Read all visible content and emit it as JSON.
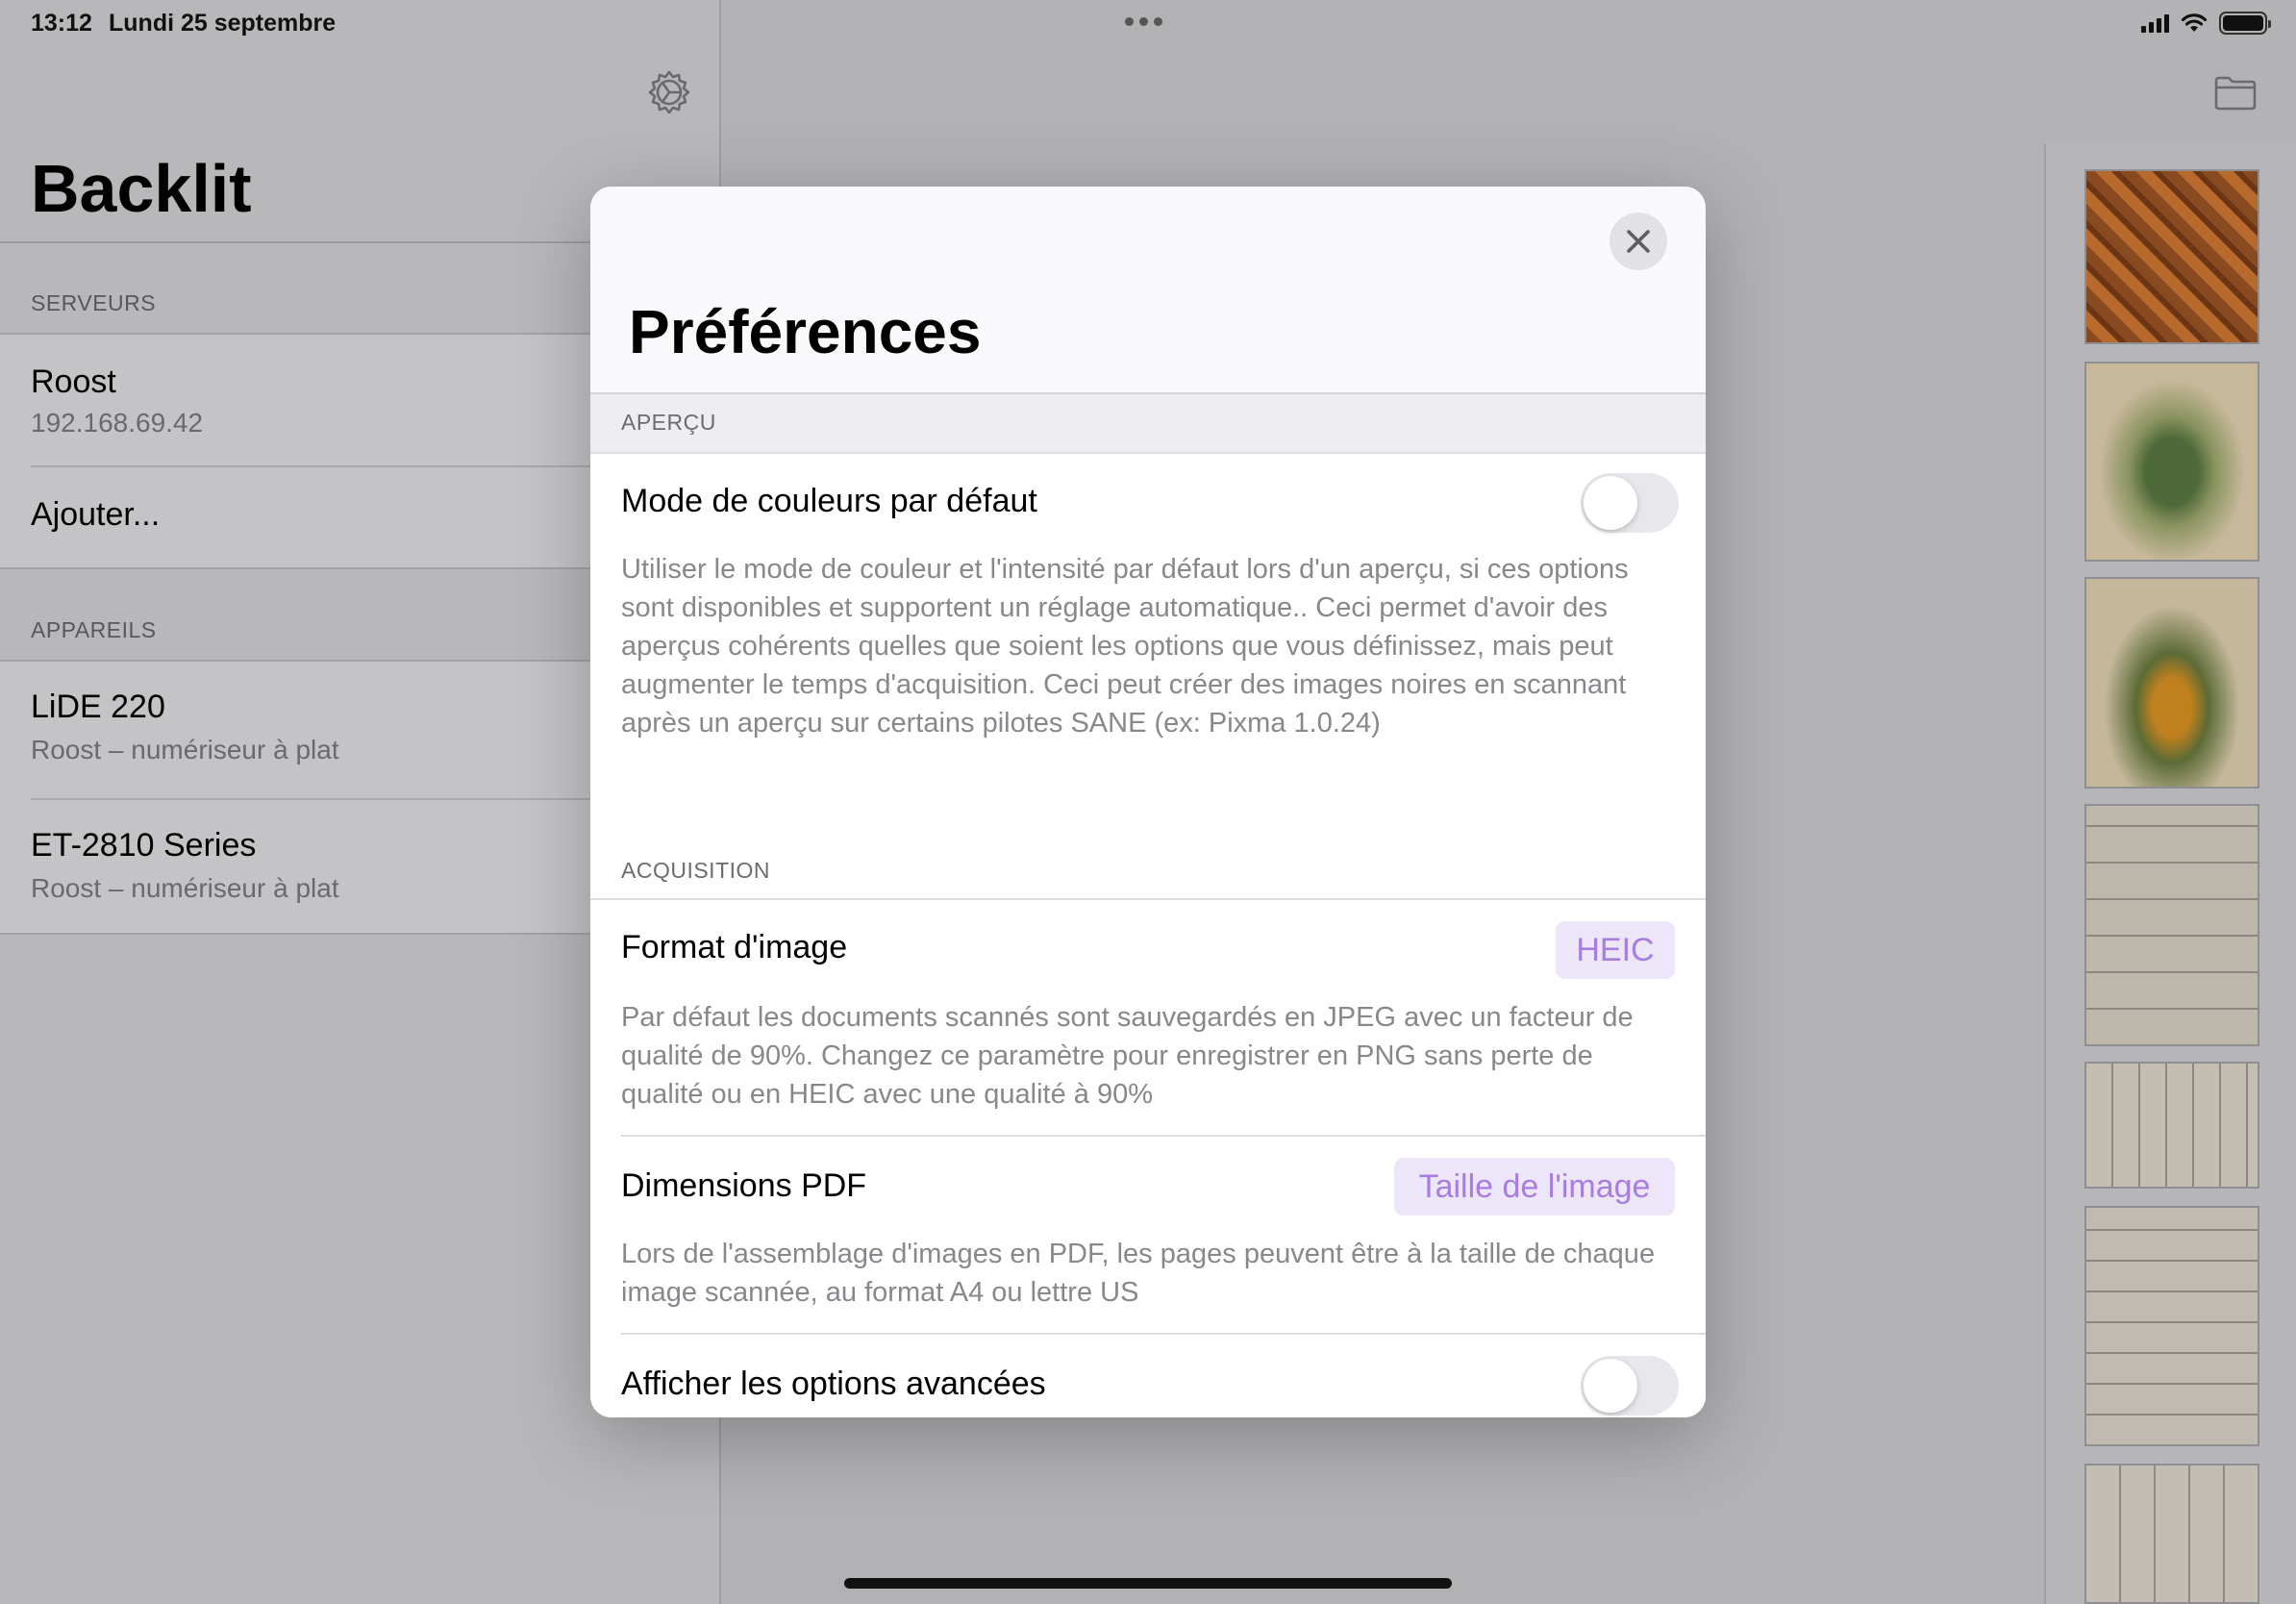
{
  "status": {
    "time": "13:12",
    "date": "Lundi 25 septembre"
  },
  "sidebar": {
    "app_title": "Backlit",
    "servers_header": "SERVEURS",
    "servers": [
      {
        "name": "Roost",
        "address": "192.168.69.42"
      }
    ],
    "add_label": "Ajouter...",
    "devices_header": "APPAREILS",
    "devices": [
      {
        "name": "LiDE 220",
        "detail": "Roost – numériseur à plat"
      },
      {
        "name": "ET-2810 Series",
        "detail": "Roost – numériseur à plat"
      }
    ]
  },
  "icons": {
    "settings": "gear-icon",
    "folder": "folder-icon",
    "close": "close-icon"
  },
  "modal": {
    "title": "Préférences",
    "preview_section": "APERÇU",
    "default_color_mode": {
      "label": "Mode de couleurs par défaut",
      "enabled": false,
      "description": "Utiliser le mode de couleur et l'intensité par défaut lors d'un aperçu, si ces options sont disponibles et supportent un réglage automatique.. Ceci permet d'avoir des aperçus cohérents quelles que soient les options que vous définissez, mais peut augmenter le temps d'acquisition. Ceci peut créer des images noires en scannant après un aperçu sur certains pilotes SANE (ex: Pixma 1.0.24)"
    },
    "acquisition_section": "ACQUISITION",
    "image_format": {
      "label": "Format d'image",
      "value": "HEIC",
      "description": "Par défaut les documents scannés sont sauvegardés en JPEG avec un facteur de qualité de 90%. Changez ce paramètre pour enregistrer en PNG sans perte de qualité ou en HEIC avec une qualité à 90%"
    },
    "pdf_dimensions": {
      "label": "Dimensions PDF",
      "value": "Taille de l'image",
      "description": "Lors de l'assemblage d'images en PDF, les pages peuvent être à la taille de chaque image scannée, au format A4 ou lettre US"
    },
    "advanced_options": {
      "label": "Afficher les options avancées",
      "enabled": false
    }
  },
  "colors": {
    "accent": "#a77ee0",
    "accent_bg": "#ece6f8"
  }
}
